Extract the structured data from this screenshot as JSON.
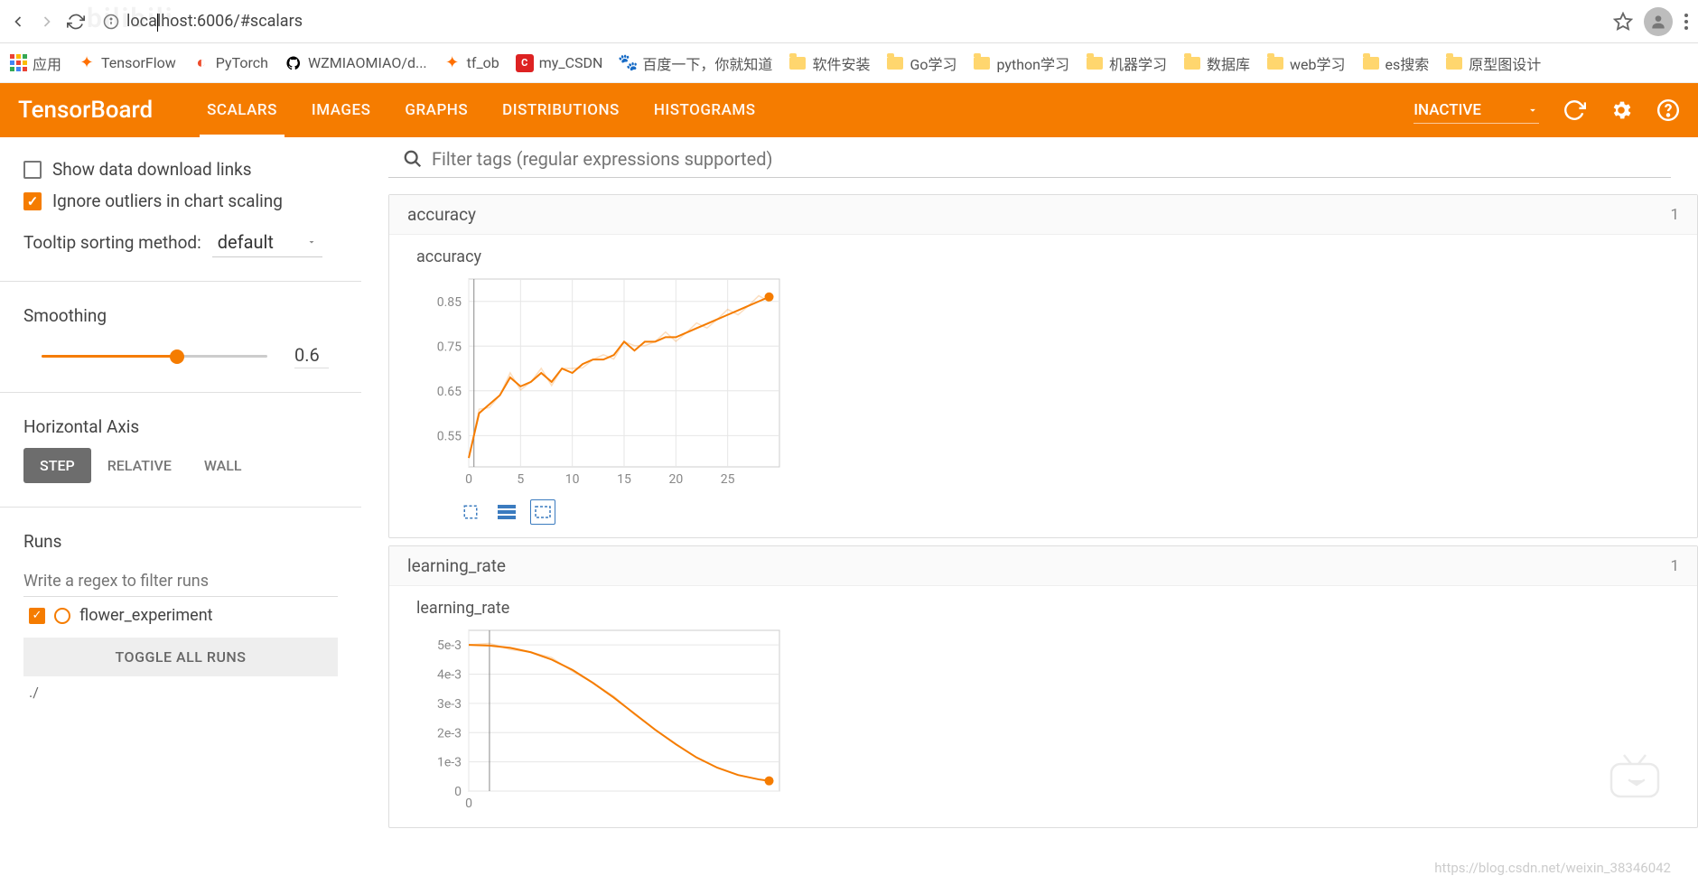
{
  "browser": {
    "url": "localhost:6006/#scalars",
    "ghost": "bilibili"
  },
  "bookmarks": [
    {
      "icon": "apps",
      "label": "应用"
    },
    {
      "icon": "tf",
      "label": "TensorFlow"
    },
    {
      "icon": "pytorch",
      "label": "PyTorch"
    },
    {
      "icon": "github",
      "label": "WZMIAOMIAO/d..."
    },
    {
      "icon": "tf",
      "label": "tf_ob"
    },
    {
      "icon": "csdn",
      "label": "my_CSDN"
    },
    {
      "icon": "baidu",
      "label": "百度一下，你就知道"
    },
    {
      "icon": "folder",
      "label": "软件安装"
    },
    {
      "icon": "folder",
      "label": "Go学习"
    },
    {
      "icon": "folder",
      "label": "python学习"
    },
    {
      "icon": "folder",
      "label": "机器学习"
    },
    {
      "icon": "folder",
      "label": "数据库"
    },
    {
      "icon": "folder",
      "label": "web学习"
    },
    {
      "icon": "folder",
      "label": "es搜索"
    },
    {
      "icon": "folder",
      "label": "原型图设计"
    }
  ],
  "header": {
    "title": "TensorBoard",
    "tabs": [
      "SCALARS",
      "IMAGES",
      "GRAPHS",
      "DISTRIBUTIONS",
      "HISTOGRAMS"
    ],
    "active_tab": "SCALARS",
    "status": "INACTIVE"
  },
  "sidebar": {
    "show_links_label": "Show data download links",
    "ignore_outliers_label": "Ignore outliers in chart scaling",
    "tooltip_label": "Tooltip sorting method:",
    "tooltip_value": "default",
    "smoothing_label": "Smoothing",
    "smoothing_value": "0.6",
    "axis_label": "Horizontal Axis",
    "axis_options": [
      "STEP",
      "RELATIVE",
      "WALL"
    ],
    "axis_active": "STEP",
    "runs_label": "Runs",
    "runs_placeholder": "Write a regex to filter runs",
    "run_name": "flower_experiment",
    "toggle_all": "TOGGLE ALL RUNS",
    "runs_path": "./"
  },
  "filter": {
    "placeholder": "Filter tags (regular expressions supported)"
  },
  "panels": [
    {
      "name": "accuracy",
      "count": "1",
      "chart_title": "accuracy"
    },
    {
      "name": "learning_rate",
      "count": "1",
      "chart_title": "learning_rate"
    }
  ],
  "chart_data": [
    {
      "type": "line",
      "title": "accuracy",
      "xlabel": "",
      "ylabel": "",
      "x": [
        0,
        1,
        2,
        3,
        4,
        5,
        6,
        7,
        8,
        9,
        10,
        11,
        12,
        13,
        14,
        15,
        16,
        17,
        18,
        19,
        20,
        21,
        22,
        23,
        24,
        25,
        26,
        27,
        28,
        29
      ],
      "values": [
        0.5,
        0.6,
        0.62,
        0.64,
        0.68,
        0.66,
        0.67,
        0.69,
        0.67,
        0.7,
        0.69,
        0.71,
        0.72,
        0.72,
        0.73,
        0.76,
        0.74,
        0.76,
        0.76,
        0.77,
        0.77,
        0.78,
        0.79,
        0.8,
        0.81,
        0.82,
        0.83,
        0.84,
        0.85,
        0.86
      ],
      "x_ticks": [
        0,
        5,
        10,
        15,
        20,
        25
      ],
      "y_ticks": [
        0.55,
        0.65,
        0.75,
        0.85
      ],
      "xlim": [
        0,
        30
      ],
      "ylim": [
        0.48,
        0.9
      ],
      "vertical_marker_x": 0.5,
      "color": "#f57c00"
    },
    {
      "type": "line",
      "title": "learning_rate",
      "xlabel": "",
      "ylabel": "",
      "x": [
        0,
        2,
        4,
        6,
        8,
        10,
        12,
        14,
        16,
        18,
        20,
        22,
        24,
        26,
        28,
        29
      ],
      "values": [
        0.005,
        0.00498,
        0.0049,
        0.00475,
        0.0045,
        0.00415,
        0.0037,
        0.0032,
        0.00265,
        0.0021,
        0.0016,
        0.00115,
        0.0008,
        0.00055,
        0.0004,
        0.00035
      ],
      "x_ticks": [
        0
      ],
      "y_ticks_labels": [
        "0",
        "1e-3",
        "2e-3",
        "3e-3",
        "4e-3",
        "5e-3"
      ],
      "y_ticks": [
        0,
        0.001,
        0.002,
        0.003,
        0.004,
        0.005
      ],
      "xlim": [
        0,
        30
      ],
      "ylim": [
        0,
        0.0055
      ],
      "vertical_marker_x": 2,
      "color": "#f57c00"
    }
  ],
  "watermark": "https://blog.csdn.net/weixin_38346042"
}
